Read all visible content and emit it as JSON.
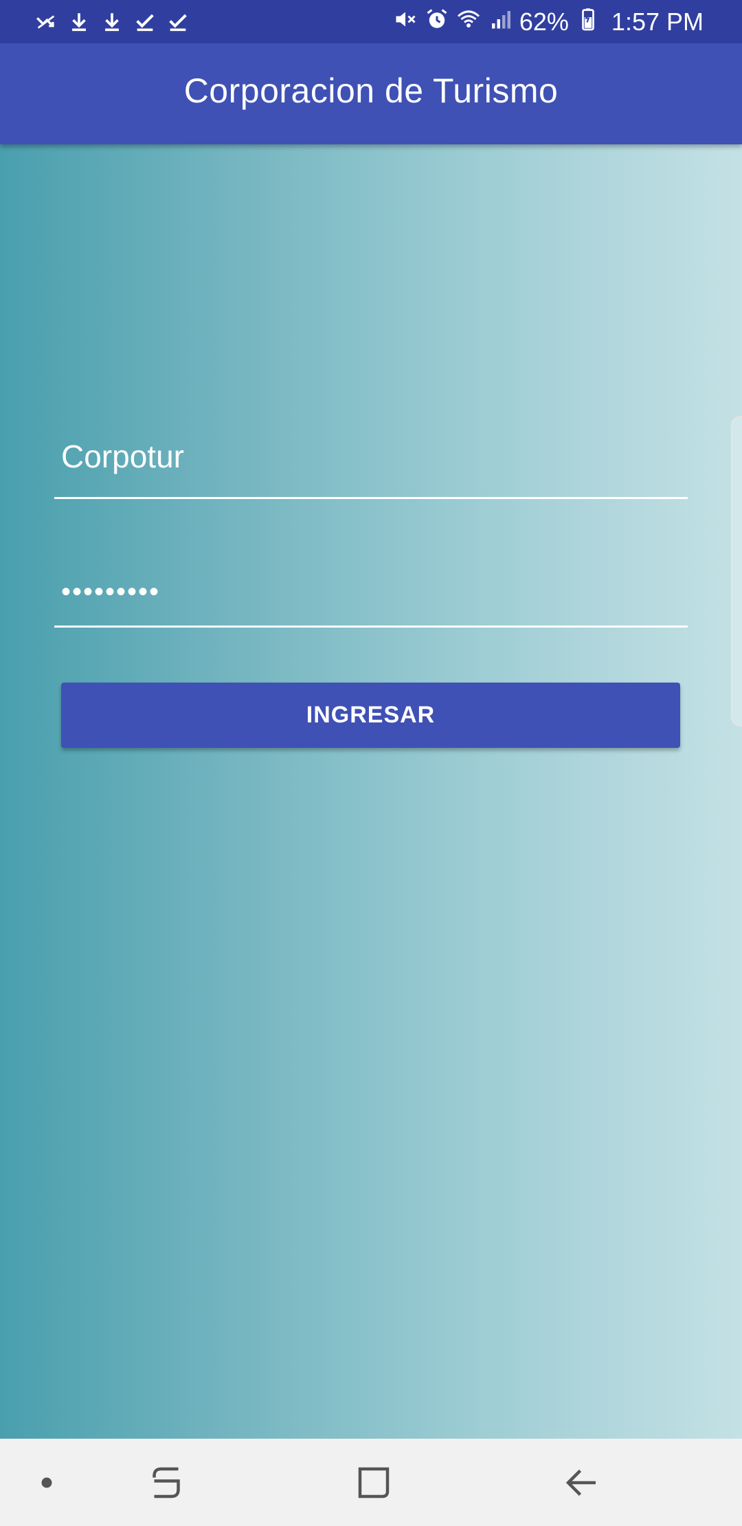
{
  "status_bar": {
    "left_icons": [
      "missed-call-icon",
      "download-icon",
      "download-icon",
      "check-icon",
      "check-icon"
    ],
    "right_icons": [
      "mute-icon",
      "alarm-icon",
      "wifi-icon",
      "signal-icon",
      "battery-icon"
    ],
    "battery_percent": "62%",
    "time": "1:57 PM"
  },
  "app_bar": {
    "title": "Corporacion de Turismo"
  },
  "login_form": {
    "username_value": "Corpotur",
    "password_value": "•••••••••",
    "submit_label": "INGRESAR"
  },
  "nav_bar": {
    "buttons": [
      "dot-icon",
      "recents-icon",
      "home-icon",
      "back-icon"
    ]
  },
  "colors": {
    "status_bar": "#303F9F",
    "app_bar": "#3F51B5",
    "button": "#3F51B5",
    "gradient_start": "#4A9FAE",
    "gradient_end": "#C4E1E5",
    "nav_bar": "#F1F1F1"
  }
}
